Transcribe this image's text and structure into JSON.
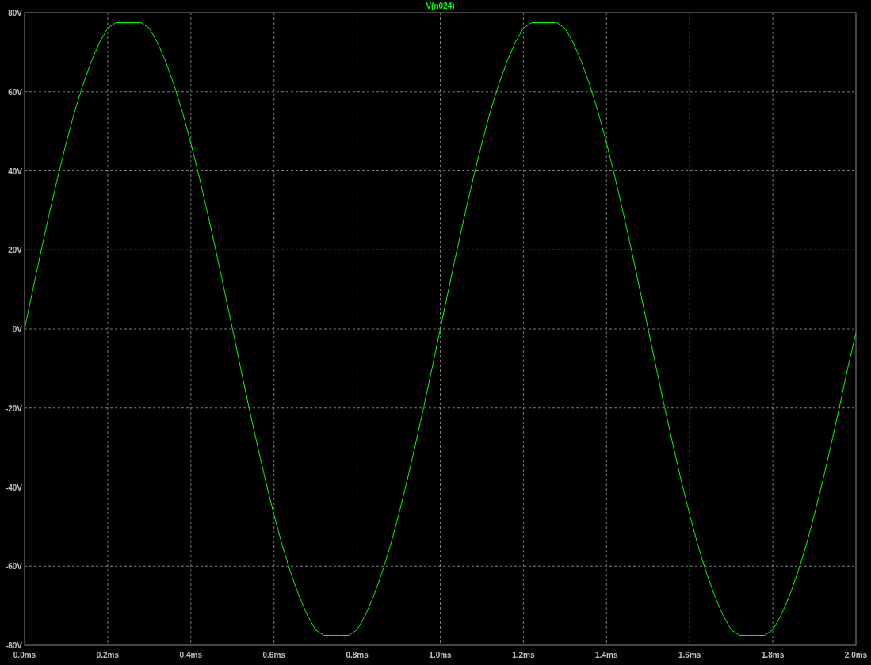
{
  "plot": {
    "chart_data": {
      "type": "line",
      "x": [
        0,
        0.02,
        0.04,
        0.06,
        0.08,
        0.1,
        0.12,
        0.14,
        0.16,
        0.18,
        0.2,
        0.22,
        0.24,
        0.26,
        0.28,
        0.3,
        0.32,
        0.34,
        0.36,
        0.38,
        0.4,
        0.42,
        0.44,
        0.46,
        0.48,
        0.5,
        0.52,
        0.54,
        0.56,
        0.58,
        0.6,
        0.62,
        0.64,
        0.66,
        0.68,
        0.7,
        0.72,
        0.74,
        0.76,
        0.78,
        0.8,
        0.82,
        0.84,
        0.86,
        0.88,
        0.9,
        0.92,
        0.94,
        0.96,
        0.98,
        1.0,
        1.02,
        1.04,
        1.06,
        1.08,
        1.1,
        1.12,
        1.14,
        1.16,
        1.18,
        1.2,
        1.22,
        1.24,
        1.26,
        1.28,
        1.3,
        1.32,
        1.34,
        1.36,
        1.38,
        1.4,
        1.42,
        1.44,
        1.46,
        1.48,
        1.5,
        1.52,
        1.54,
        1.56,
        1.58,
        1.6,
        1.62,
        1.64,
        1.66,
        1.68,
        1.7,
        1.72,
        1.74,
        1.76,
        1.78,
        1.8,
        1.82,
        1.84,
        1.86,
        1.88,
        1.9,
        1.92,
        1.94,
        1.96,
        1.98,
        2.0
      ],
      "series": [
        {
          "name": "V(n024)",
          "color": "#00ff00",
          "values": [
            0,
            10,
            19.9,
            29.4,
            38.5,
            47,
            54.8,
            61.6,
            67.5,
            72.4,
            76.1,
            77.5,
            77.5,
            77.5,
            77.5,
            76.1,
            72.4,
            67.5,
            61.6,
            54.8,
            47,
            38.5,
            29.4,
            19.9,
            10,
            0,
            -10,
            -19.9,
            -29.4,
            -38.5,
            -47,
            -54.8,
            -61.6,
            -67.5,
            -72.4,
            -76.1,
            -77.5,
            -77.5,
            -77.5,
            -77.5,
            -76.1,
            -72.4,
            -67.5,
            -61.6,
            -54.8,
            -47,
            -38.5,
            -29.4,
            -19.9,
            -10,
            0,
            10,
            19.9,
            29.4,
            38.5,
            47,
            54.8,
            61.6,
            67.5,
            72.4,
            76.1,
            77.5,
            77.5,
            77.5,
            77.5,
            76.1,
            72.4,
            67.5,
            61.6,
            54.8,
            47,
            38.5,
            29.4,
            19.9,
            10,
            0,
            -10,
            -19.9,
            -29.4,
            -38.5,
            -47,
            -54.8,
            -61.6,
            -67.5,
            -72.4,
            -76.1,
            -77.5,
            -77.5,
            -77.5,
            -77.5,
            -76.1,
            -72.4,
            -67.5,
            -61.6,
            -54.8,
            -47,
            -38.5,
            -29.4,
            -19.9,
            -10,
            -1
          ]
        }
      ],
      "grid": true,
      "xlim": [
        0,
        2
      ],
      "ylim": [
        -80,
        80
      ],
      "xticks": [
        {
          "value": 0,
          "label": "0.0ms"
        },
        {
          "value": 0.2,
          "label": "0.2ms"
        },
        {
          "value": 0.4,
          "label": "0.4ms"
        },
        {
          "value": 0.6,
          "label": "0.6ms"
        },
        {
          "value": 0.8,
          "label": "0.8ms"
        },
        {
          "value": 1.0,
          "label": "1.0ms"
        },
        {
          "value": 1.2,
          "label": "1.2ms"
        },
        {
          "value": 1.4,
          "label": "1.4ms"
        },
        {
          "value": 1.6,
          "label": "1.6ms"
        },
        {
          "value": 1.8,
          "label": "1.8ms"
        },
        {
          "value": 2.0,
          "label": "2.0ms"
        }
      ],
      "yticks": [
        {
          "value": 80,
          "label": "80V"
        },
        {
          "value": 60,
          "label": "60V"
        },
        {
          "value": 40,
          "label": "40V"
        },
        {
          "value": 20,
          "label": "20V"
        },
        {
          "value": 0,
          "label": "0V"
        },
        {
          "value": -20,
          "label": "-20V"
        },
        {
          "value": -40,
          "label": "-40V"
        },
        {
          "value": -60,
          "label": "-60V"
        },
        {
          "value": -80,
          "label": "-80V"
        }
      ]
    }
  }
}
